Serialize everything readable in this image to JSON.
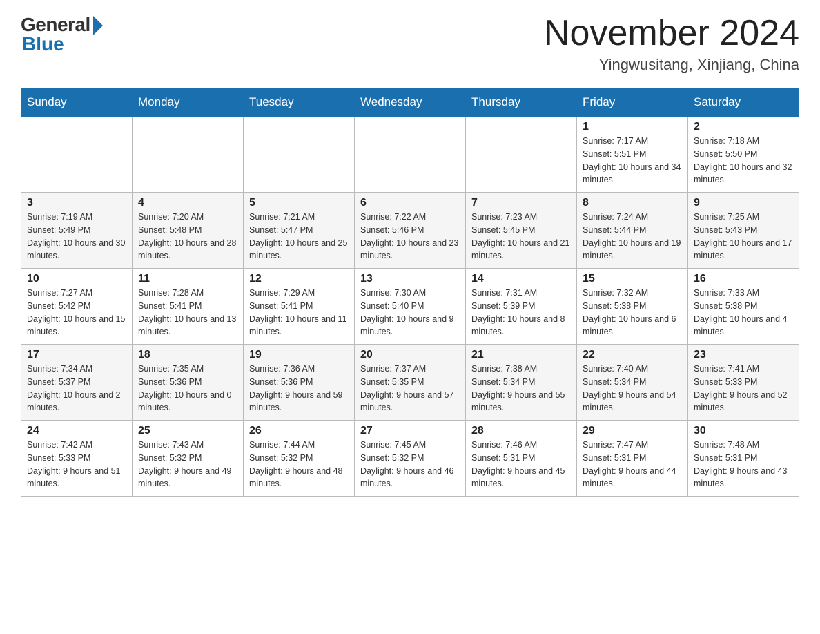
{
  "logo": {
    "general": "General",
    "blue": "Blue"
  },
  "title": "November 2024",
  "location": "Yingwusitang, Xinjiang, China",
  "days_of_week": [
    "Sunday",
    "Monday",
    "Tuesday",
    "Wednesday",
    "Thursday",
    "Friday",
    "Saturday"
  ],
  "weeks": [
    [
      {
        "day": "",
        "info": ""
      },
      {
        "day": "",
        "info": ""
      },
      {
        "day": "",
        "info": ""
      },
      {
        "day": "",
        "info": ""
      },
      {
        "day": "",
        "info": ""
      },
      {
        "day": "1",
        "info": "Sunrise: 7:17 AM\nSunset: 5:51 PM\nDaylight: 10 hours and 34 minutes."
      },
      {
        "day": "2",
        "info": "Sunrise: 7:18 AM\nSunset: 5:50 PM\nDaylight: 10 hours and 32 minutes."
      }
    ],
    [
      {
        "day": "3",
        "info": "Sunrise: 7:19 AM\nSunset: 5:49 PM\nDaylight: 10 hours and 30 minutes."
      },
      {
        "day": "4",
        "info": "Sunrise: 7:20 AM\nSunset: 5:48 PM\nDaylight: 10 hours and 28 minutes."
      },
      {
        "day": "5",
        "info": "Sunrise: 7:21 AM\nSunset: 5:47 PM\nDaylight: 10 hours and 25 minutes."
      },
      {
        "day": "6",
        "info": "Sunrise: 7:22 AM\nSunset: 5:46 PM\nDaylight: 10 hours and 23 minutes."
      },
      {
        "day": "7",
        "info": "Sunrise: 7:23 AM\nSunset: 5:45 PM\nDaylight: 10 hours and 21 minutes."
      },
      {
        "day": "8",
        "info": "Sunrise: 7:24 AM\nSunset: 5:44 PM\nDaylight: 10 hours and 19 minutes."
      },
      {
        "day": "9",
        "info": "Sunrise: 7:25 AM\nSunset: 5:43 PM\nDaylight: 10 hours and 17 minutes."
      }
    ],
    [
      {
        "day": "10",
        "info": "Sunrise: 7:27 AM\nSunset: 5:42 PM\nDaylight: 10 hours and 15 minutes."
      },
      {
        "day": "11",
        "info": "Sunrise: 7:28 AM\nSunset: 5:41 PM\nDaylight: 10 hours and 13 minutes."
      },
      {
        "day": "12",
        "info": "Sunrise: 7:29 AM\nSunset: 5:41 PM\nDaylight: 10 hours and 11 minutes."
      },
      {
        "day": "13",
        "info": "Sunrise: 7:30 AM\nSunset: 5:40 PM\nDaylight: 10 hours and 9 minutes."
      },
      {
        "day": "14",
        "info": "Sunrise: 7:31 AM\nSunset: 5:39 PM\nDaylight: 10 hours and 8 minutes."
      },
      {
        "day": "15",
        "info": "Sunrise: 7:32 AM\nSunset: 5:38 PM\nDaylight: 10 hours and 6 minutes."
      },
      {
        "day": "16",
        "info": "Sunrise: 7:33 AM\nSunset: 5:38 PM\nDaylight: 10 hours and 4 minutes."
      }
    ],
    [
      {
        "day": "17",
        "info": "Sunrise: 7:34 AM\nSunset: 5:37 PM\nDaylight: 10 hours and 2 minutes."
      },
      {
        "day": "18",
        "info": "Sunrise: 7:35 AM\nSunset: 5:36 PM\nDaylight: 10 hours and 0 minutes."
      },
      {
        "day": "19",
        "info": "Sunrise: 7:36 AM\nSunset: 5:36 PM\nDaylight: 9 hours and 59 minutes."
      },
      {
        "day": "20",
        "info": "Sunrise: 7:37 AM\nSunset: 5:35 PM\nDaylight: 9 hours and 57 minutes."
      },
      {
        "day": "21",
        "info": "Sunrise: 7:38 AM\nSunset: 5:34 PM\nDaylight: 9 hours and 55 minutes."
      },
      {
        "day": "22",
        "info": "Sunrise: 7:40 AM\nSunset: 5:34 PM\nDaylight: 9 hours and 54 minutes."
      },
      {
        "day": "23",
        "info": "Sunrise: 7:41 AM\nSunset: 5:33 PM\nDaylight: 9 hours and 52 minutes."
      }
    ],
    [
      {
        "day": "24",
        "info": "Sunrise: 7:42 AM\nSunset: 5:33 PM\nDaylight: 9 hours and 51 minutes."
      },
      {
        "day": "25",
        "info": "Sunrise: 7:43 AM\nSunset: 5:32 PM\nDaylight: 9 hours and 49 minutes."
      },
      {
        "day": "26",
        "info": "Sunrise: 7:44 AM\nSunset: 5:32 PM\nDaylight: 9 hours and 48 minutes."
      },
      {
        "day": "27",
        "info": "Sunrise: 7:45 AM\nSunset: 5:32 PM\nDaylight: 9 hours and 46 minutes."
      },
      {
        "day": "28",
        "info": "Sunrise: 7:46 AM\nSunset: 5:31 PM\nDaylight: 9 hours and 45 minutes."
      },
      {
        "day": "29",
        "info": "Sunrise: 7:47 AM\nSunset: 5:31 PM\nDaylight: 9 hours and 44 minutes."
      },
      {
        "day": "30",
        "info": "Sunrise: 7:48 AM\nSunset: 5:31 PM\nDaylight: 9 hours and 43 minutes."
      }
    ]
  ]
}
